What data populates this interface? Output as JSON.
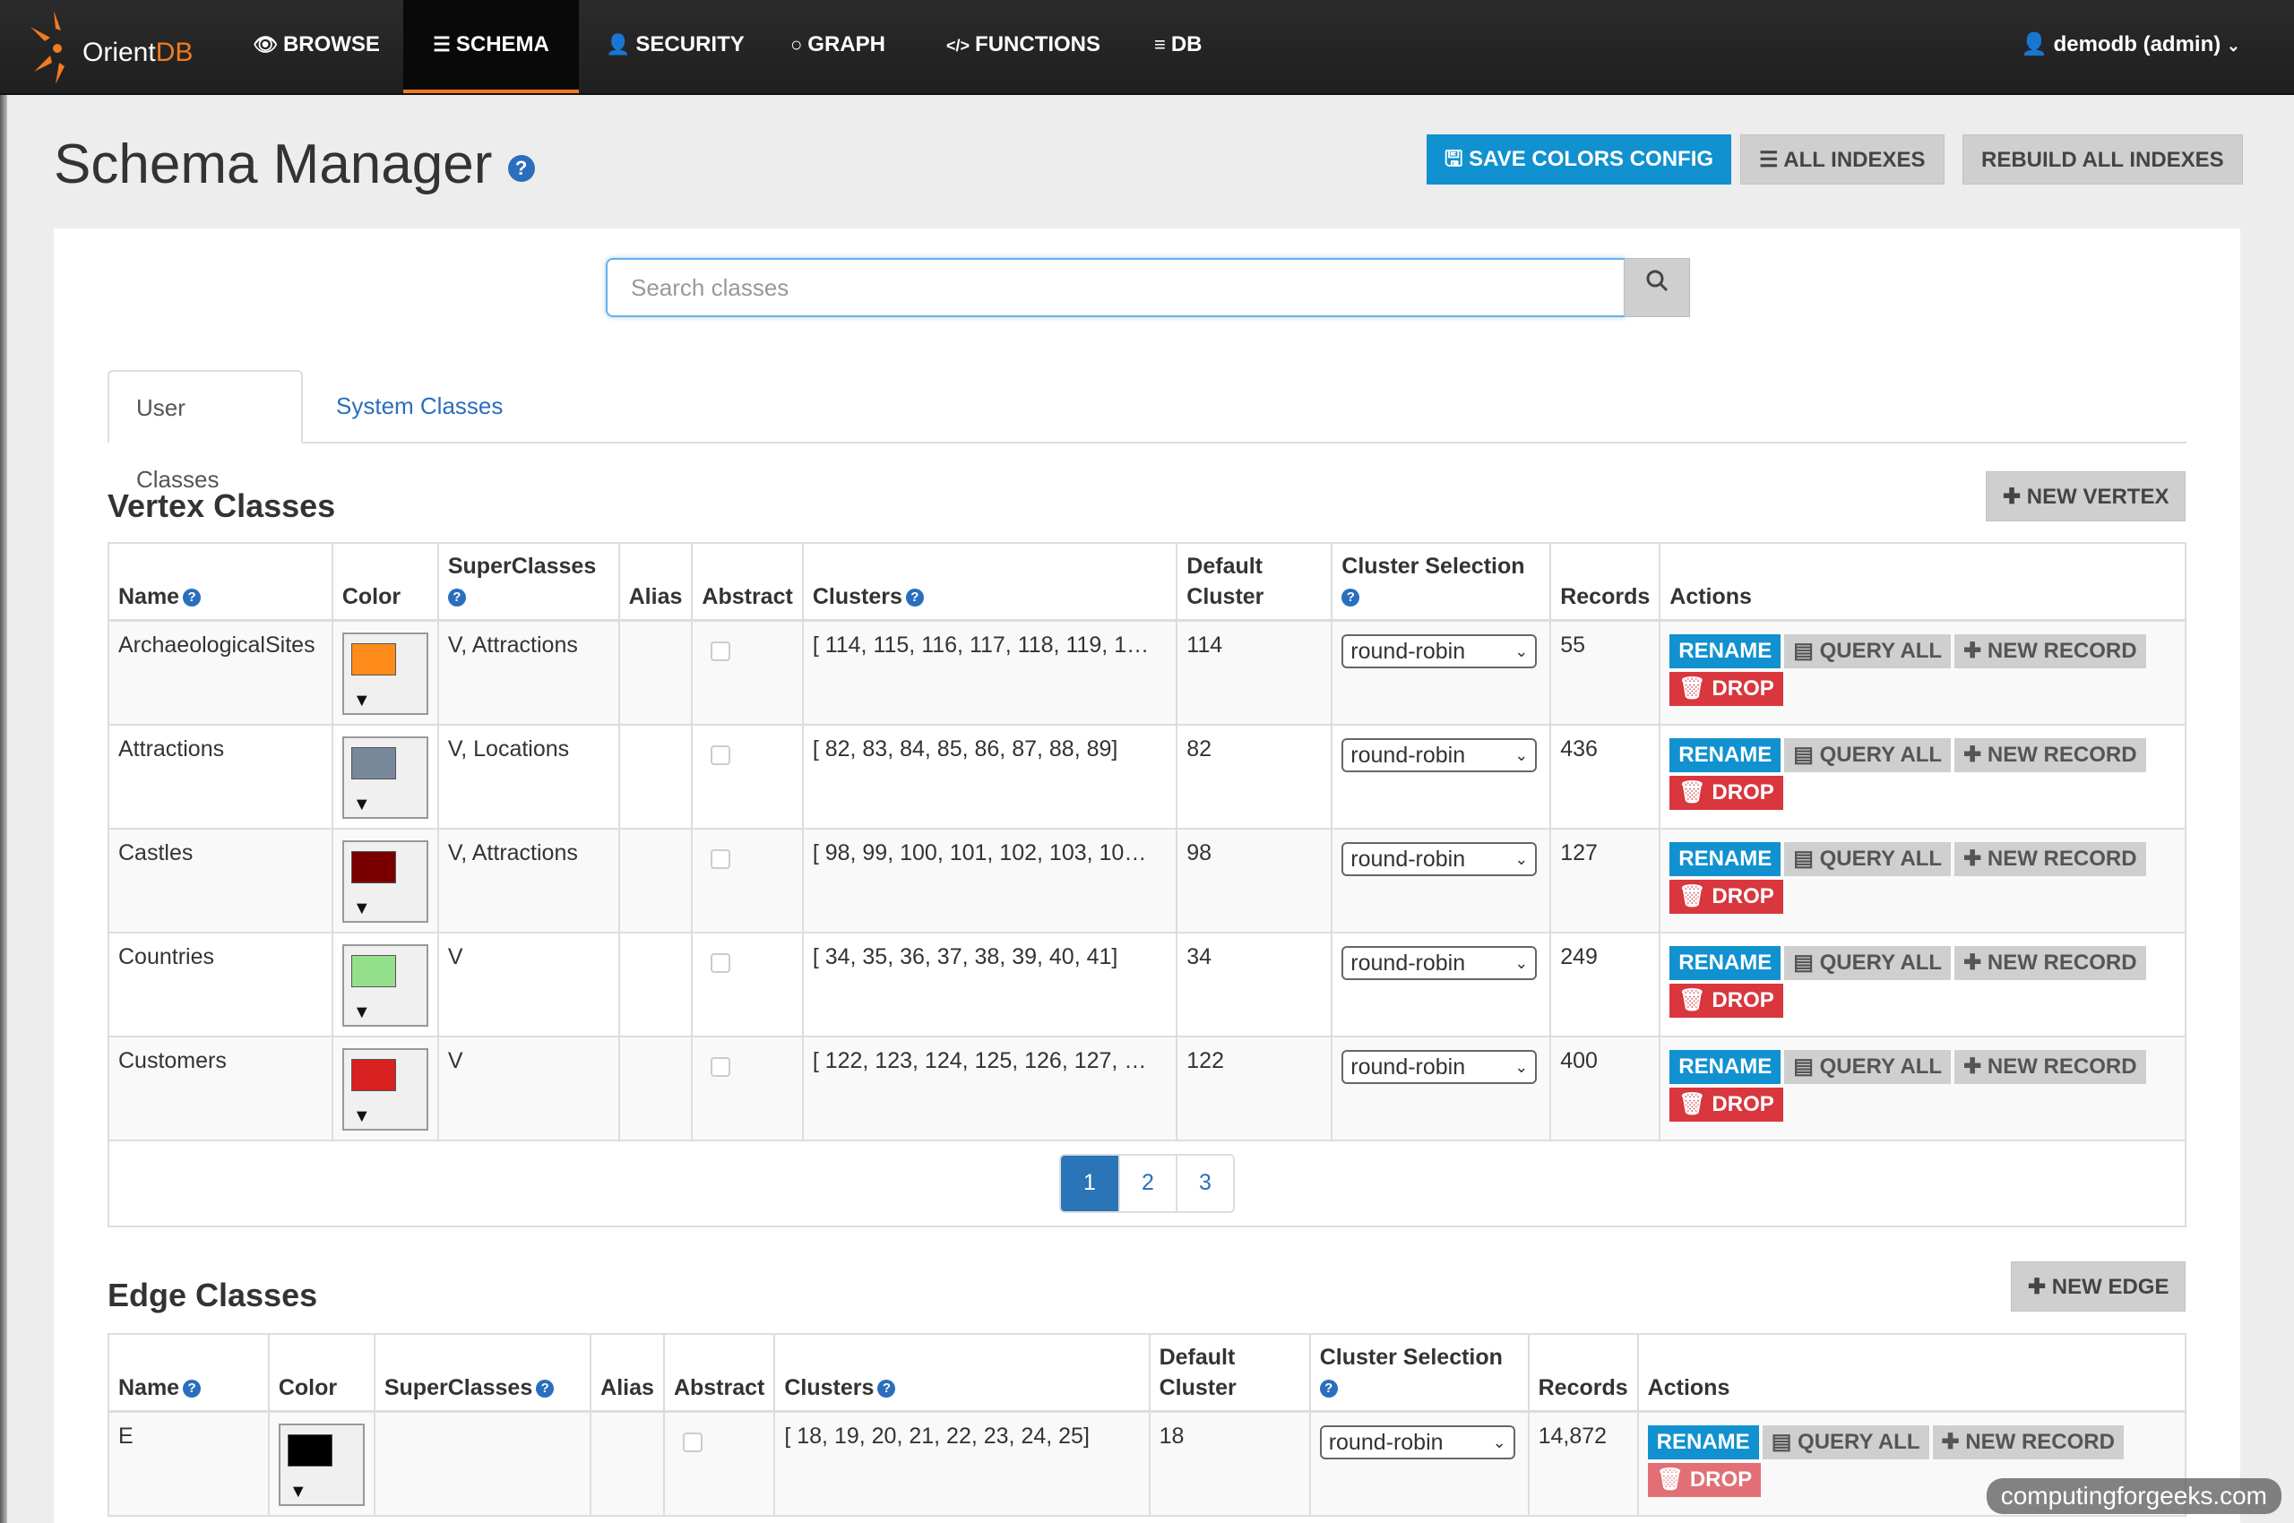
{
  "navbar": {
    "logo_text_1": "Orient",
    "logo_text_2": "DB",
    "items": [
      {
        "label": "BROWSE",
        "icon": "eye-icon"
      },
      {
        "label": "SCHEMA",
        "icon": "list-icon"
      },
      {
        "label": "SECURITY",
        "icon": "user-icon"
      },
      {
        "label": "GRAPH",
        "icon": "circle-icon"
      },
      {
        "label": "FUNCTIONS",
        "icon": "code-icon"
      },
      {
        "label": "DB",
        "icon": "database-icon"
      }
    ],
    "active_item": "SCHEMA",
    "user_label": "demodb (admin)",
    "accent_color": "#f37a21"
  },
  "header": {
    "title": "Schema Manager",
    "save_colors_label": "SAVE COLORS CONFIG",
    "all_indexes_label": "ALL INDEXES",
    "rebuild_indexes_label": "REBUILD ALL INDEXES"
  },
  "search": {
    "placeholder": "Search classes"
  },
  "tabs": {
    "user": "User Classes",
    "system": "System Classes"
  },
  "vertex": {
    "title": "Vertex Classes",
    "new_button": "NEW VERTEX",
    "columns": {
      "name": "Name",
      "color": "Color",
      "superclasses": "SuperClasses",
      "alias": "Alias",
      "abstract": "Abstract",
      "clusters": "Clusters",
      "default_cluster_1": "Default",
      "default_cluster_2": "Cluster",
      "cluster_selection": "Cluster Selection",
      "records": "Records",
      "actions": "Actions"
    },
    "rows": [
      {
        "name": "ArchaeologicalSites",
        "color": "#ff8c1a",
        "superclasses": "V, Attractions",
        "clusters": "[ 114, 115, 116, 117, 118, 119, 1…",
        "default_cluster": "114",
        "selection": "round-robin",
        "records": "55"
      },
      {
        "name": "Attractions",
        "color": "#77889a",
        "superclasses": "V, Locations",
        "clusters": "[ 82, 83, 84, 85, 86, 87, 88, 89]",
        "default_cluster": "82",
        "selection": "round-robin",
        "records": "436"
      },
      {
        "name": "Castles",
        "color": "#7a0000",
        "superclasses": "V, Attractions",
        "clusters": "[ 98, 99, 100, 101, 102, 103, 10…",
        "default_cluster": "98",
        "selection": "round-robin",
        "records": "127"
      },
      {
        "name": "Countries",
        "color": "#94e08a",
        "superclasses": "V",
        "clusters": "[ 34, 35, 36, 37, 38, 39, 40, 41]",
        "default_cluster": "34",
        "selection": "round-robin",
        "records": "249"
      },
      {
        "name": "Customers",
        "color": "#d92020",
        "superclasses": "V",
        "clusters": "[ 122, 123, 124, 125, 126, 127, …",
        "default_cluster": "122",
        "selection": "round-robin",
        "records": "400"
      }
    ],
    "pages": [
      "1",
      "2",
      "3"
    ],
    "active_page": "1"
  },
  "edge": {
    "title": "Edge Classes",
    "new_button": "NEW EDGE",
    "rows": [
      {
        "name": "E",
        "color": "#000000",
        "superclasses": "",
        "clusters": "[ 18, 19, 20, 21, 22, 23, 24, 25]",
        "default_cluster": "18",
        "selection": "round-robin",
        "records": "14,872"
      }
    ]
  },
  "actions": {
    "rename": "RENAME",
    "query_all": "QUERY ALL",
    "new_record": "NEW RECORD",
    "drop": "DROP"
  },
  "watermark": "computingforgeeks.com"
}
